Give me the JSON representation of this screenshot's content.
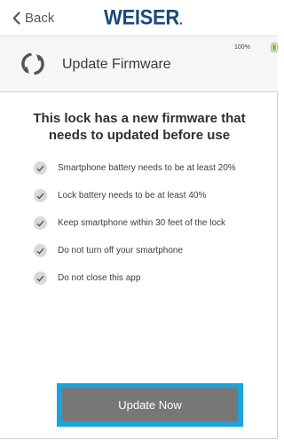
{
  "nav": {
    "back_label": "Back",
    "logo_text": "WEISER",
    "logo_dot": ".",
    "logo_color": "#1c4a7a"
  },
  "header": {
    "title": "Update Firmware",
    "battery_percent_text": "100%",
    "battery_icon": "battery-icon",
    "sync_icon": "sync-icon"
  },
  "main": {
    "headline": "This lock has a new firmware that needs to updated before use",
    "requirements": [
      "Smartphone battery needs to be at least 20%",
      "Lock battery needs to be at least 40%",
      "Keep smartphone within 30 feet of the lock",
      "Do not turn off your smartphone",
      "Do not close this app"
    ],
    "check_icon": "checkmark-icon"
  },
  "button": {
    "label": "Update Now",
    "fill_color": "#777777",
    "highlight_color": "#1aa3dd"
  }
}
